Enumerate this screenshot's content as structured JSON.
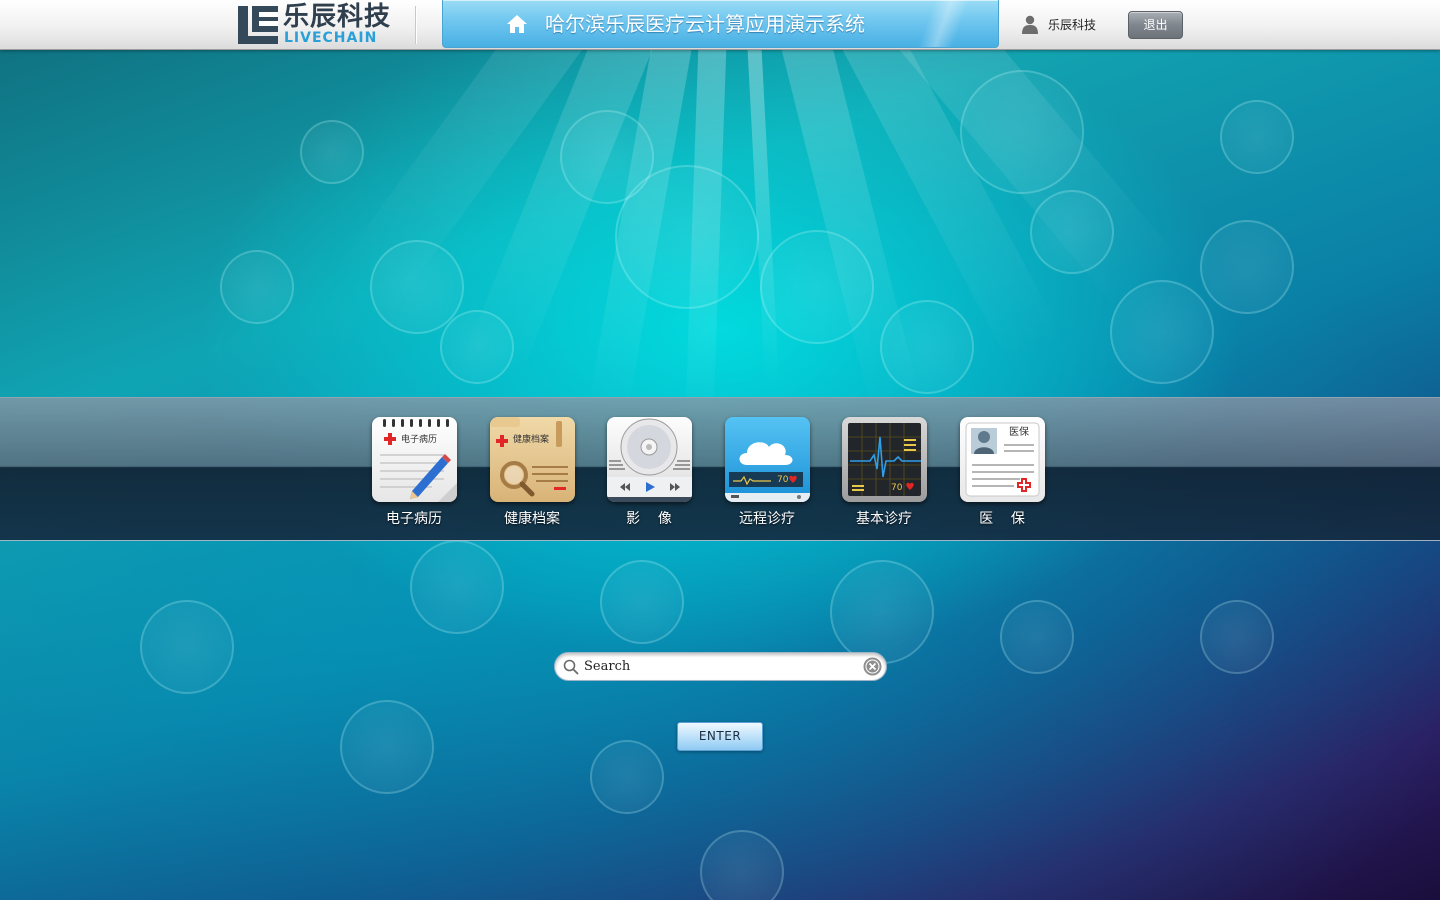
{
  "header": {
    "logo": {
      "cn": "乐辰科技",
      "en": "LIVECHAIN"
    },
    "title": "哈尔滨乐辰医疗云计算应用演示系统",
    "user_name": "乐辰科技",
    "logout_label": "退出"
  },
  "apps": [
    {
      "id": "emr",
      "label": "电子病历",
      "icon": "notebook-pen-icon",
      "tile_text": "电子病历"
    },
    {
      "id": "health",
      "label": "健康档案",
      "icon": "folder-magnifier-icon",
      "tile_text": "健康档案"
    },
    {
      "id": "image",
      "label": "影    像",
      "icon": "disc-player-icon"
    },
    {
      "id": "remote",
      "label": "远程诊疗",
      "icon": "cloud-monitor-icon",
      "reading": "70"
    },
    {
      "id": "basic",
      "label": "基本诊疗",
      "icon": "ecg-monitor-icon",
      "reading": "70"
    },
    {
      "id": "insure",
      "label": "医    保",
      "icon": "insurance-card-icon",
      "tile_text": "医保"
    }
  ],
  "search": {
    "placeholder": "Search",
    "value": ""
  },
  "enter_label": "ENTER",
  "colors": {
    "title_panel": "#6fc6ef",
    "logo_dark": "#34495a",
    "logo_accent": "#2aa0d8",
    "background_teal": "#12a3b0",
    "background_purple": "#2b1d62"
  }
}
